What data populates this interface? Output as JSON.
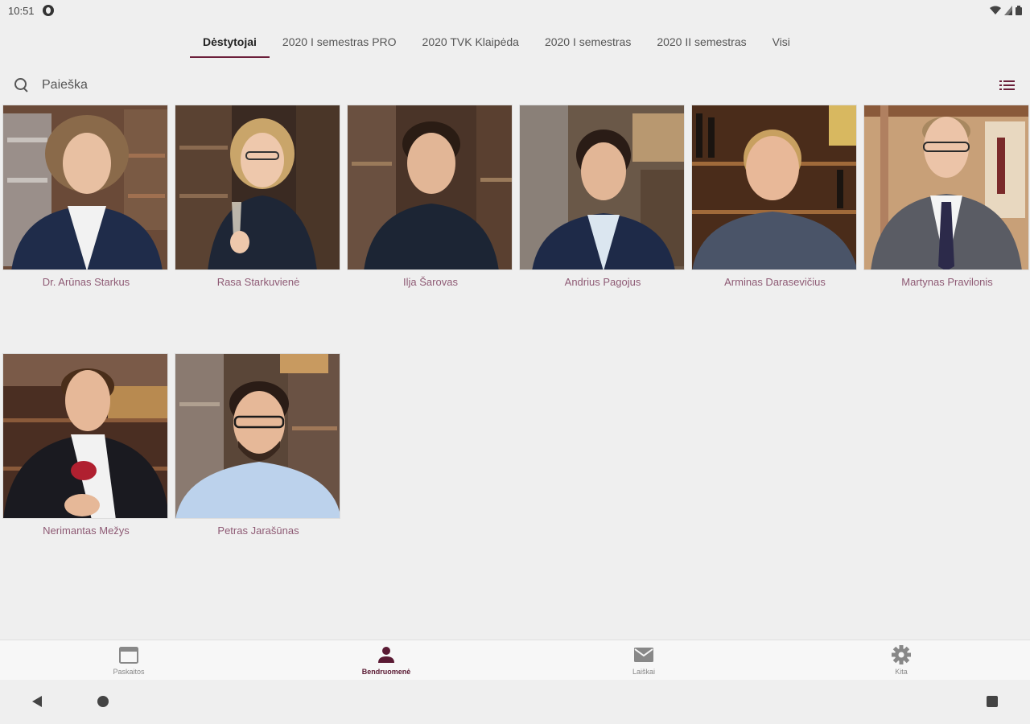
{
  "status_bar": {
    "time": "10:51"
  },
  "tabs": [
    {
      "label": "Dėstytojai",
      "active": true
    },
    {
      "label": "2020 I semestras PRO",
      "active": false
    },
    {
      "label": "2020 TVK Klaipėda",
      "active": false
    },
    {
      "label": "2020 I semestras",
      "active": false
    },
    {
      "label": "2020 II semestras",
      "active": false
    },
    {
      "label": "Visi",
      "active": false
    }
  ],
  "search": {
    "placeholder": "Paieška",
    "value": ""
  },
  "lecturers": [
    {
      "name": "Dr. Arūnas Starkus"
    },
    {
      "name": "Rasa Starkuvienė"
    },
    {
      "name": "Ilja Šarovas"
    },
    {
      "name": "Andrius Pagojus"
    },
    {
      "name": "Arminas Darasevičius"
    },
    {
      "name": "Martynas Pravilonis"
    },
    {
      "name": "Nerimantas Mežys"
    },
    {
      "name": "Petras Jarašūnas"
    }
  ],
  "bottom_nav": [
    {
      "label": "Paskaitos",
      "icon": "calendar-icon",
      "active": false
    },
    {
      "label": "Bendruomenė",
      "icon": "person-icon",
      "active": true
    },
    {
      "label": "Laiškai",
      "icon": "mail-icon",
      "active": false
    },
    {
      "label": "Kita",
      "icon": "gear-icon",
      "active": false
    }
  ],
  "colors": {
    "accent": "#6b1f3a",
    "name_text": "#8e5a74",
    "background": "#efefef"
  }
}
